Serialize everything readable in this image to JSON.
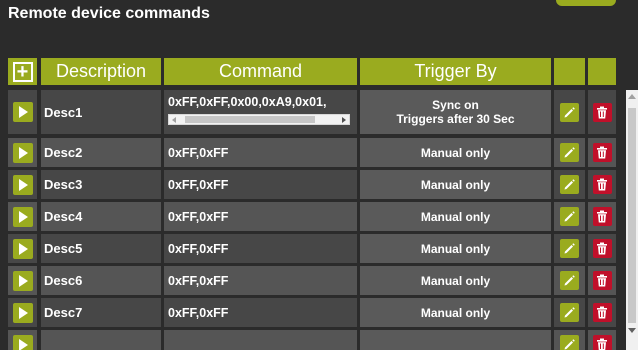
{
  "title": "Remote device commands",
  "header": {
    "add_label": "+",
    "description": "Description",
    "command": "Command",
    "trigger": "Trigger By"
  },
  "rows": [
    {
      "desc": "Desc1",
      "command": "0xFF,0xFF,0x00,0xA9,0x01,",
      "trigger_line1": "Sync on",
      "trigger_line2": "Triggers after 30 Sec"
    },
    {
      "desc": "Desc2",
      "command": "0xFF,0xFF",
      "trigger": "Manual only"
    },
    {
      "desc": "Desc3",
      "command": "0xFF,0xFF",
      "trigger": "Manual only"
    },
    {
      "desc": "Desc4",
      "command": "0xFF,0xFF",
      "trigger": "Manual only"
    },
    {
      "desc": "Desc5",
      "command": "0xFF,0xFF",
      "trigger": "Manual only"
    },
    {
      "desc": "Desc6",
      "command": "0xFF,0xFF",
      "trigger": "Manual only"
    },
    {
      "desc": "Desc7",
      "command": "0xFF,0xFF",
      "trigger": "Manual only"
    }
  ],
  "colors": {
    "accent": "#9aab1f",
    "delete": "#c0102a",
    "cell": "#474747",
    "cell_alt": "#555555"
  },
  "icons": {
    "play": "play-icon",
    "edit": "pencil-icon",
    "delete": "trash-icon",
    "add": "plus-icon"
  }
}
